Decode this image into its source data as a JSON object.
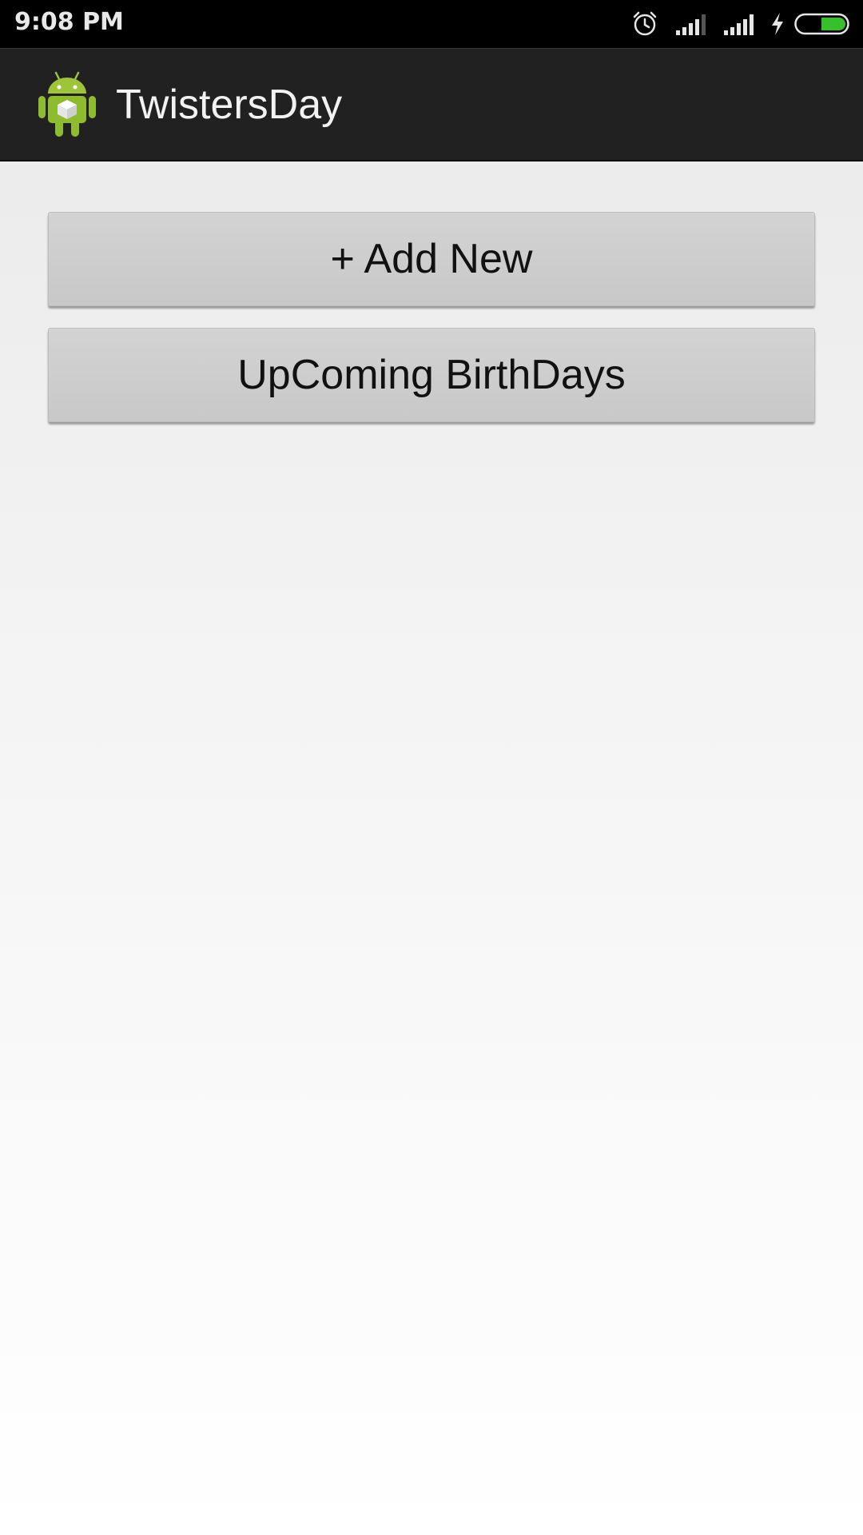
{
  "status_bar": {
    "time": "9:08 PM",
    "icons": [
      "alarm-icon",
      "signal-icon",
      "signal-icon",
      "charging-icon",
      "battery-icon"
    ],
    "battery_color": "#36c02a"
  },
  "action_bar": {
    "title": "TwistersDay",
    "icon": "android-app-icon",
    "background": "#212121"
  },
  "main": {
    "buttons": [
      {
        "label": "+ Add New"
      },
      {
        "label": "UpComing BirthDays"
      }
    ]
  }
}
